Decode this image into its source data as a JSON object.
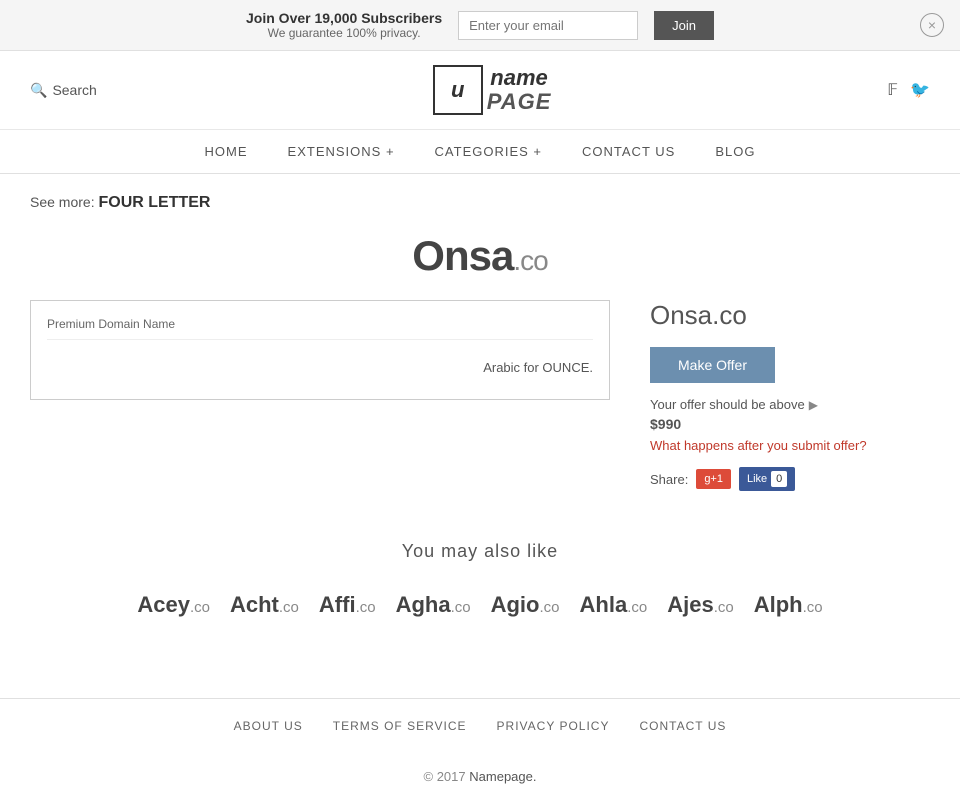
{
  "banner": {
    "main_text": "Join Over 19,000 Subscribers",
    "sub_text": "We guarantee 100% privacy.",
    "email_placeholder": "Enter your email",
    "join_label": "Join",
    "close_label": "×"
  },
  "header": {
    "search_label": "Search",
    "logo_icon": "u",
    "logo_name": "name",
    "logo_page": "PAGE",
    "social": {
      "facebook": "f",
      "twitter": "t"
    }
  },
  "nav": {
    "items": [
      {
        "label": "HOME",
        "key": "home"
      },
      {
        "label": "EXTENSIONS +",
        "key": "extensions"
      },
      {
        "label": "CATEGORIES +",
        "key": "categories"
      },
      {
        "label": "CONTACT US",
        "key": "contact"
      },
      {
        "label": "BLOG",
        "key": "blog"
      }
    ]
  },
  "page": {
    "see_more_label": "See more:",
    "see_more_value": "FOUR LETTER",
    "domain_name": "Onsa",
    "domain_tld": ".co",
    "card_label": "Premium Domain Name",
    "card_description": "Arabic for OUNCE.",
    "offer_domain": "Onsa.co",
    "make_offer_label": "Make Offer",
    "offer_hint": "Your offer should be above",
    "offer_price": "$990",
    "offer_link": "What happens after you submit offer?",
    "share_label": "Share:",
    "gplus_label": "g+1",
    "fb_like_label": "Like",
    "fb_count": "0"
  },
  "also_like": {
    "title": "You may also like",
    "domains": [
      {
        "name": "Acey",
        "tld": ".co"
      },
      {
        "name": "Acht",
        "tld": ".co"
      },
      {
        "name": "Affi",
        "tld": ".co"
      },
      {
        "name": "Agha",
        "tld": ".co"
      },
      {
        "name": "Agio",
        "tld": ".co"
      },
      {
        "name": "Ahla",
        "tld": ".co"
      },
      {
        "name": "Ajes",
        "tld": ".co"
      },
      {
        "name": "Alph",
        "tld": ".co"
      }
    ]
  },
  "footer": {
    "links": [
      {
        "label": "ABOUT US",
        "key": "about"
      },
      {
        "label": "TERMS OF SERVICE",
        "key": "terms"
      },
      {
        "label": "PRIVACY POLICY",
        "key": "privacy"
      },
      {
        "label": "CONTACT US",
        "key": "contact"
      }
    ],
    "copyright": "© 2017",
    "brand": "Namepage."
  }
}
